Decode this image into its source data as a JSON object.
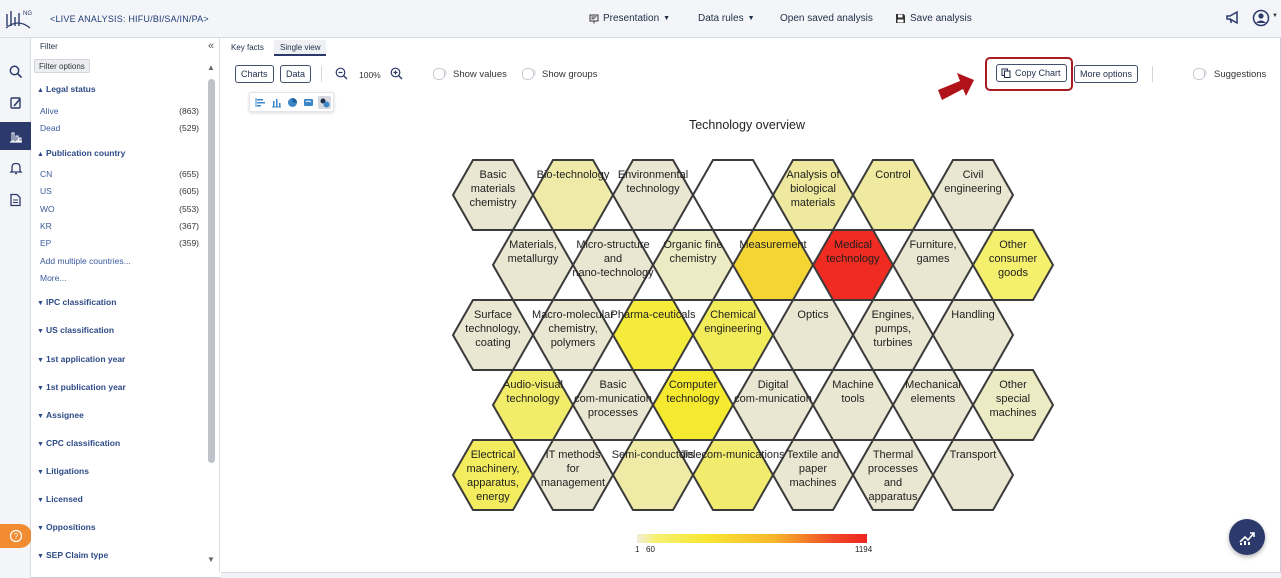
{
  "header": {
    "analysis_title": "<LIVE ANALYSIS: HIFU/BI/SA/IN/PA>",
    "logo_text": "NG",
    "menu": [
      {
        "label": "Presentation",
        "icon": "presentation-icon",
        "dropdown": true
      },
      {
        "label": "Data rules",
        "dropdown": true
      },
      {
        "label": "Open saved analysis"
      },
      {
        "label": "Save analysis",
        "icon": "save-icon"
      }
    ]
  },
  "rail": {
    "items": [
      "search-icon",
      "notes-icon",
      "charts-icon",
      "bell-icon",
      "report-icon"
    ],
    "active_index": 2
  },
  "filter": {
    "tab_label": "Filter",
    "options_button": "Filter options",
    "sections": [
      {
        "title": "Legal status",
        "expanded": true,
        "items": [
          {
            "label": "Alive",
            "count": "(863)"
          },
          {
            "label": "Dead",
            "count": "(529)"
          }
        ]
      },
      {
        "title": "Publication country",
        "expanded": true,
        "items": [
          {
            "label": "CN",
            "count": "(655)"
          },
          {
            "label": "US",
            "count": "(605)"
          },
          {
            "label": "WO",
            "count": "(553)"
          },
          {
            "label": "KR",
            "count": "(367)"
          },
          {
            "label": "EP",
            "count": "(359)"
          }
        ],
        "links": [
          "Add multiple countries...",
          "More..."
        ]
      },
      {
        "title": "IPC classification",
        "expanded": false
      },
      {
        "title": "US classification",
        "expanded": false
      },
      {
        "title": "1st application year",
        "expanded": false
      },
      {
        "title": "1st publication year",
        "expanded": false
      },
      {
        "title": "Assignee",
        "expanded": false
      },
      {
        "title": "CPC classification",
        "expanded": false
      },
      {
        "title": "Litigations",
        "expanded": false
      },
      {
        "title": "Licensed",
        "expanded": false
      },
      {
        "title": "Oppositions",
        "expanded": false
      },
      {
        "title": "SEP Claim type",
        "expanded": false
      }
    ]
  },
  "main": {
    "tabs": [
      {
        "label": "Key facts",
        "active": false
      },
      {
        "label": "Single view",
        "active": true
      }
    ],
    "toolbar": {
      "charts": "Charts",
      "data": "Data",
      "zoom": "100%",
      "show_values": "Show values",
      "show_groups": "Show groups",
      "copy_chart": "Copy Chart",
      "more_options": "More options",
      "suggestions": "Suggestions"
    }
  },
  "colors": {
    "accent": "#2b3a6b",
    "highlight": "#a61c22",
    "scale_low": "#f6f071",
    "scale_high": "#ee2420",
    "empty": "#e9e6d6"
  },
  "chart_data": {
    "type": "heatmap",
    "title": "Technology overview",
    "layout": "hexagonal",
    "scale": {
      "min_label": "1",
      "low_label": "60",
      "max_label": "1194"
    },
    "cells": [
      {
        "row": 0,
        "col": 0,
        "label": "Basic materials chemistry",
        "color": "#e9e6d2"
      },
      {
        "row": 0,
        "col": 1,
        "label": "Bio-technology",
        "color": "#efeaa8"
      },
      {
        "row": 0,
        "col": 2,
        "label": "Environmental technology",
        "color": "#e9e6d2"
      },
      {
        "row": 0,
        "col": 3,
        "label": "",
        "color": "#ffffff"
      },
      {
        "row": 0,
        "col": 4,
        "label": "Analysis of biological materials",
        "color": "#eee99e"
      },
      {
        "row": 0,
        "col": 5,
        "label": "Control",
        "color": "#efea9f"
      },
      {
        "row": 0,
        "col": 6,
        "label": "Civil engineering",
        "color": "#e9e6d2"
      },
      {
        "row": 1,
        "col": 0,
        "label": "Materials, metallurgy",
        "color": "#e9e6d2"
      },
      {
        "row": 1,
        "col": 1,
        "label": "Micro-structure and nano-technology",
        "color": "#e9e6d2"
      },
      {
        "row": 1,
        "col": 2,
        "label": "Organic fine chemistry",
        "color": "#ecebc4"
      },
      {
        "row": 1,
        "col": 3,
        "label": "Measurement",
        "color": "#f5d534"
      },
      {
        "row": 1,
        "col": 4,
        "label": "Medical technology",
        "color": "#ef2b22"
      },
      {
        "row": 1,
        "col": 5,
        "label": "Furniture, games",
        "color": "#e9e6d2"
      },
      {
        "row": 1,
        "col": 6,
        "label": "Other consumer goods",
        "color": "#f5ef6e"
      },
      {
        "row": 2,
        "col": 0,
        "label": "Surface technology, coating",
        "color": "#e9e6d2"
      },
      {
        "row": 2,
        "col": 1,
        "label": "Macro-molecular chemistry, polymers",
        "color": "#e9e6d2"
      },
      {
        "row": 2,
        "col": 2,
        "label": "Pharma-ceuticals",
        "color": "#f5eb3a"
      },
      {
        "row": 2,
        "col": 3,
        "label": "Chemical engineering",
        "color": "#f3ec5a"
      },
      {
        "row": 2,
        "col": 4,
        "label": "Optics",
        "color": "#e9e6d2"
      },
      {
        "row": 2,
        "col": 5,
        "label": "Engines, pumps, turbines",
        "color": "#e9e6d2"
      },
      {
        "row": 2,
        "col": 6,
        "label": "Handling",
        "color": "#e9e6d2"
      },
      {
        "row": 3,
        "col": 0,
        "label": "Audio-visual technology",
        "color": "#f1ec6a"
      },
      {
        "row": 3,
        "col": 1,
        "label": "Basic com-munication processes",
        "color": "#e9e6d2"
      },
      {
        "row": 3,
        "col": 2,
        "label": "Computer technology",
        "color": "#f6ea30"
      },
      {
        "row": 3,
        "col": 3,
        "label": "Digital com-munication",
        "color": "#e9e6d2"
      },
      {
        "row": 3,
        "col": 4,
        "label": "Machine tools",
        "color": "#e9e6d2"
      },
      {
        "row": 3,
        "col": 5,
        "label": "Mechanical elements",
        "color": "#e9e6d2"
      },
      {
        "row": 3,
        "col": 6,
        "label": "Other special machines",
        "color": "#ecebc4"
      },
      {
        "row": 4,
        "col": 0,
        "label": "Electrical machinery, apparatus, energy",
        "color": "#f2ec5e"
      },
      {
        "row": 4,
        "col": 1,
        "label": "IT methods for management",
        "color": "#e9e6d2"
      },
      {
        "row": 4,
        "col": 2,
        "label": "Semi-conductors",
        "color": "#efeaa6"
      },
      {
        "row": 4,
        "col": 3,
        "label": "Telecom-munications",
        "color": "#f1ec6e"
      },
      {
        "row": 4,
        "col": 4,
        "label": "Textile and paper machines",
        "color": "#e9e6d2"
      },
      {
        "row": 4,
        "col": 5,
        "label": "Thermal processes and apparatus",
        "color": "#e9e6d2"
      },
      {
        "row": 4,
        "col": 6,
        "label": "Transport",
        "color": "#e9e6d2"
      }
    ]
  }
}
